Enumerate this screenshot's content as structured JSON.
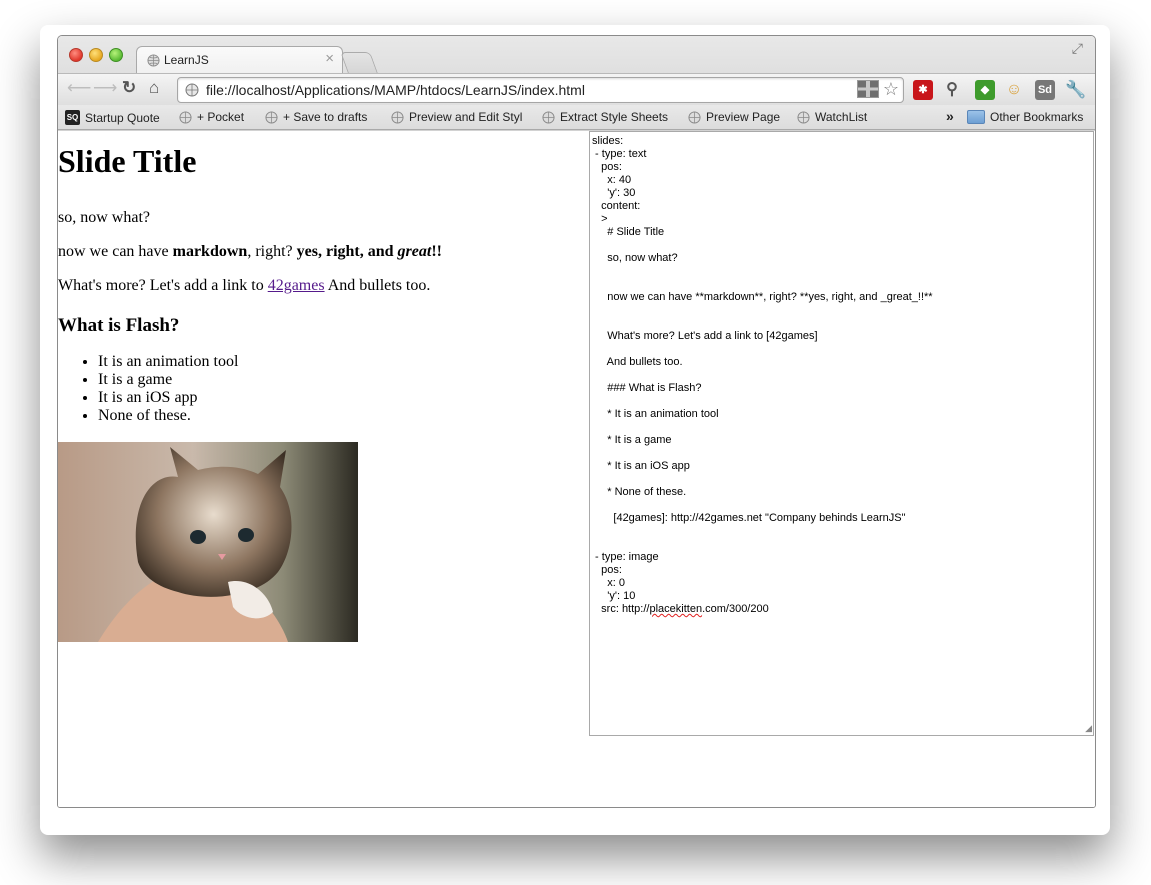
{
  "browser": {
    "tab_title": "LearnJS",
    "url": "file://localhost/Applications/MAMP/htdocs/LearnJS/index.html",
    "extensions": [
      {
        "name": "lastpass",
        "label": "*",
        "color": "#cc1b1b"
      },
      {
        "name": "usb-extension",
        "label": "",
        "color": "#ffffff"
      },
      {
        "name": "evernote",
        "label": "",
        "color": "#4ea532"
      },
      {
        "name": "avatar-extension",
        "label": "",
        "color": "#f0c36a"
      },
      {
        "name": "sd-extension",
        "label": "Sd",
        "color": "#777777"
      }
    ]
  },
  "bookmarks": {
    "items": [
      {
        "label": "Startup Quote",
        "icon": "sq-icon"
      },
      {
        "label": "+ Pocket",
        "icon": "globe-icon"
      },
      {
        "label": "+ Save to drafts",
        "icon": "globe-icon"
      },
      {
        "label": "Preview and Edit Styl",
        "icon": "globe-icon"
      },
      {
        "label": "Extract Style Sheets",
        "icon": "globe-icon"
      },
      {
        "label": "Preview Page",
        "icon": "globe-icon"
      },
      {
        "label": "WatchList",
        "icon": "globe-icon"
      }
    ],
    "overflow": "»",
    "other_label": "Other Bookmarks",
    "sq_text": "SQ"
  },
  "slide": {
    "title": "Slide Title",
    "p1": "so, now what?",
    "p2_a": "now we can have ",
    "p2_bold": "markdown",
    "p2_b": ", right? ",
    "p2_bold2": "yes, right, and ",
    "p2_bolditalic": "great",
    "p2_end": "!!",
    "p3_a": "What's more? Let's add a link to ",
    "p3_link": "42games",
    "p3_b": " And bullets too.",
    "subheading": "What is Flash?",
    "bullets": [
      "It is an animation tool",
      "It is a game",
      "It is an iOS app",
      "None of these."
    ]
  },
  "editor": {
    "lines_before": "slides:\n - type: text\n   pos:\n     x: 40\n     'y': 30\n   content:\n   >\n     # Slide Title\n\n     so, now what?\n\n\n     now we can have **markdown**, right? **yes, right, and _great_!!**\n\n\n     What's more? Let's add a link to [42games]\n\n     And bullets too.\n\n     ### What is Flash?\n\n     * It is an animation tool\n\n     * It is a game\n\n     * It is an iOS app\n\n     * None of these.\n\n       [42games]: http://42games.net \"Company behinds LearnJS\"\n\n\n - type: image\n   pos:\n     x: 0\n     'y': 10\n   src: http://",
    "src_word": "placekitten",
    "src_after": ".com/300/200"
  }
}
